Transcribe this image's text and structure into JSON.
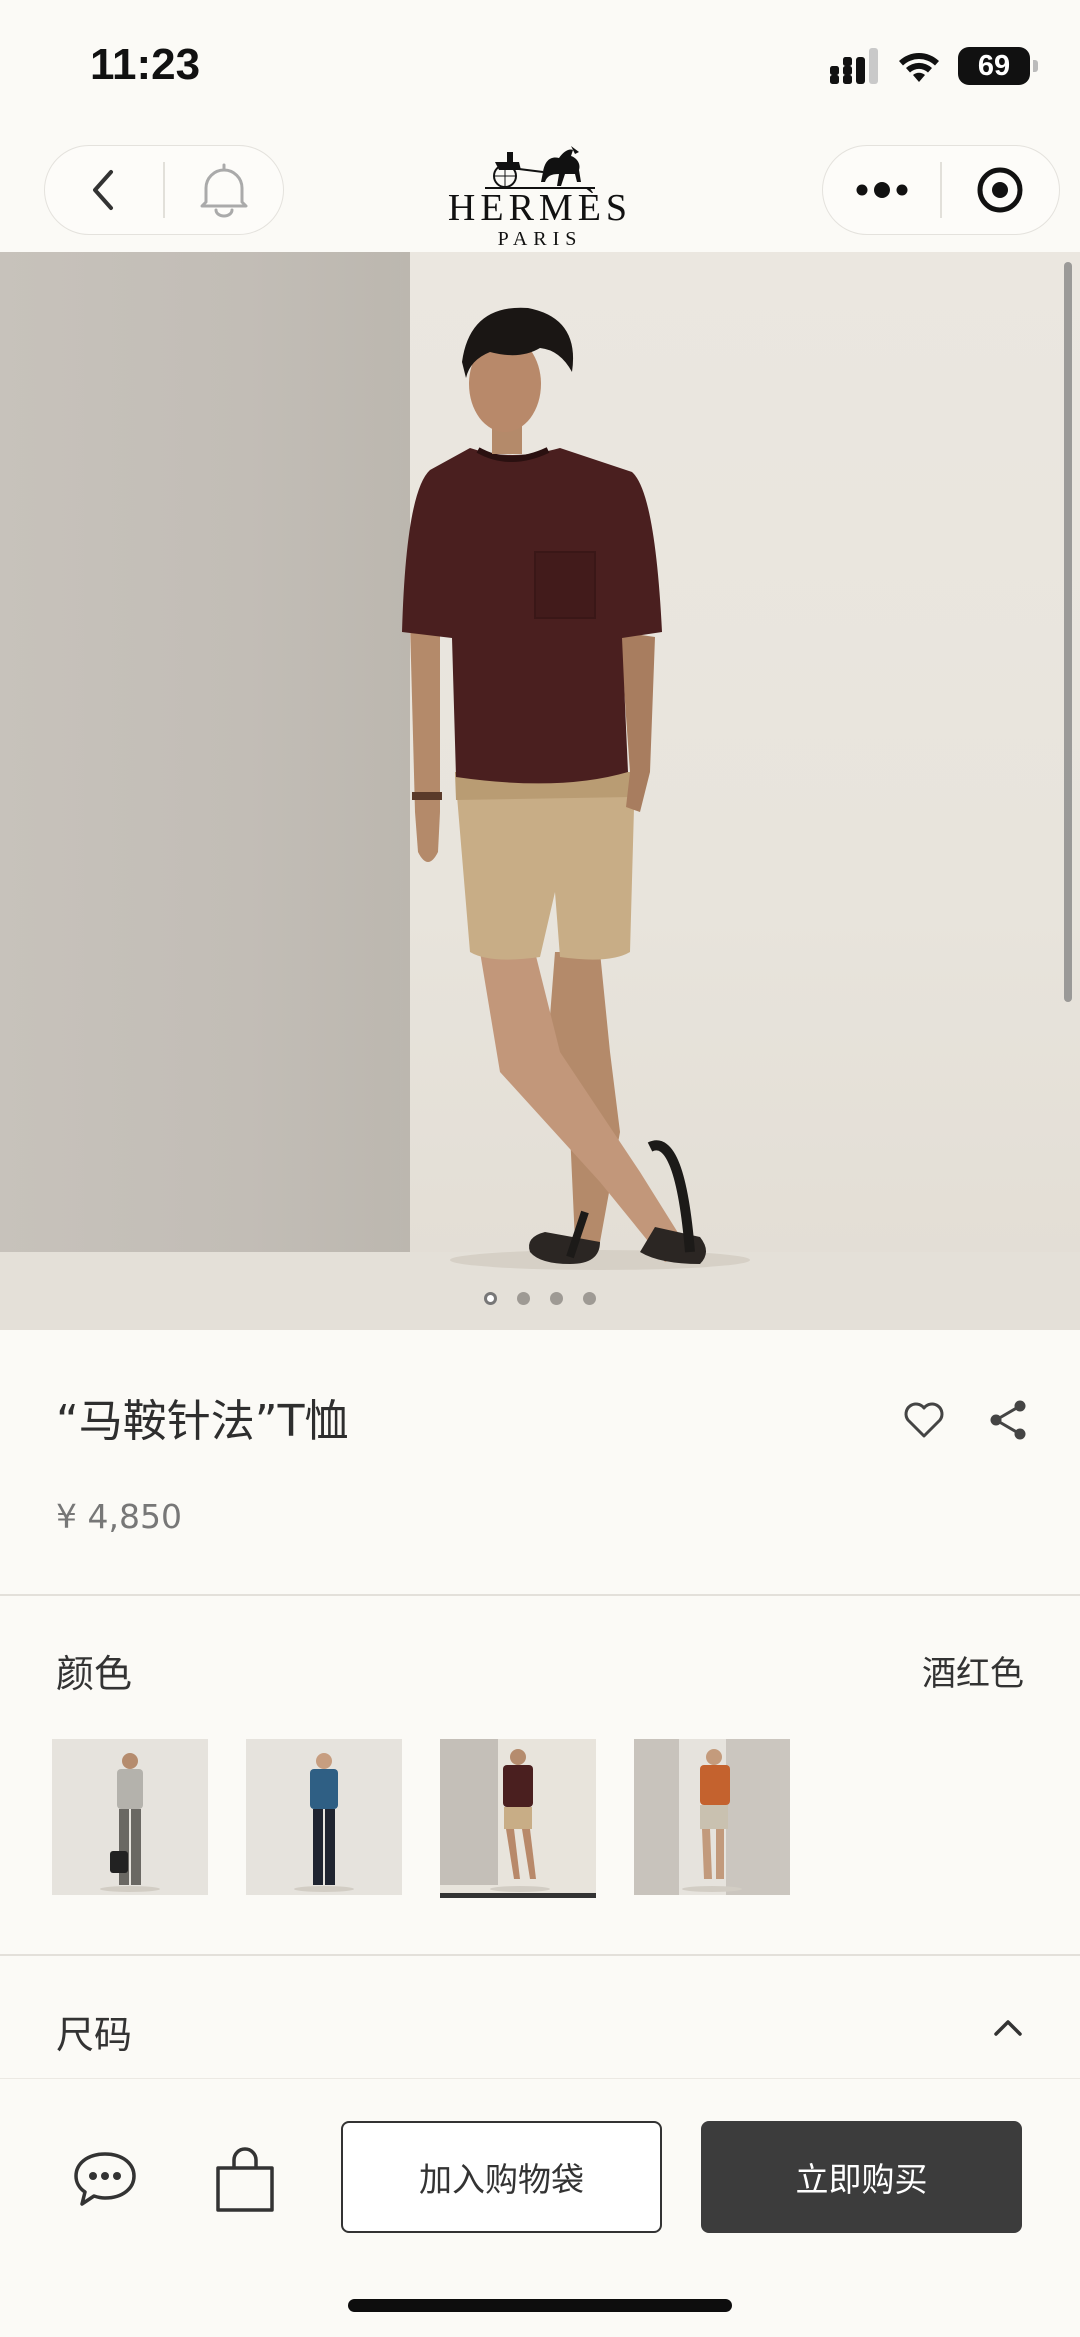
{
  "status_bar": {
    "time": "11:23",
    "battery": "69"
  },
  "header": {
    "brand": "HERMÈS",
    "brand_sub": "PARIS"
  },
  "hero": {
    "slide_count": 4,
    "active_slide": 1
  },
  "product": {
    "title": "“马鞍针法”T恤",
    "price": "¥ 4,850"
  },
  "color": {
    "label": "颜色",
    "selected": "酒红色",
    "swatches": [
      {
        "name": "grey",
        "shirt": "#b4b2ac",
        "pants": "#6a6863"
      },
      {
        "name": "blue",
        "shirt": "#2f5f84",
        "pants": "#1f2430"
      },
      {
        "name": "burgundy",
        "shirt": "#4a1f1f",
        "pants": "#c9b08a",
        "selected": true
      },
      {
        "name": "orange",
        "shirt": "#c4622e",
        "pants": "#c9c1b0"
      }
    ]
  },
  "size": {
    "label": "尺码"
  },
  "bottom_bar": {
    "add_to_bag": "加入购物袋",
    "buy_now": "立即购买"
  },
  "colors": {
    "background": "#fbfaf6",
    "buy_button": "#3c3c3c",
    "text": "#333333"
  }
}
